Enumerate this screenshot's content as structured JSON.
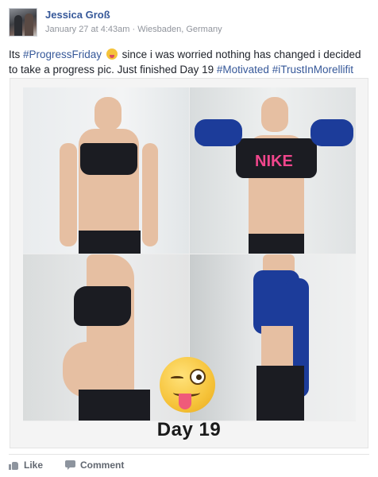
{
  "post": {
    "author": "Jessica Groß",
    "date": "January 27 at 4:43am",
    "separator": "·",
    "location": "Wiesbaden, Germany",
    "text": {
      "part1": "Its ",
      "hashtag1": "#ProgressFriday",
      "part2": " since i was worried nothing has changed i decided",
      "part3": "to take a progress pic. Just finished Day 19 ",
      "hashtag2": "#Motivated",
      "space": " ",
      "hashtag3": "#iTrustInMorellifit"
    },
    "image": {
      "caption": "Day 19",
      "shirt_text": "NIKE"
    }
  },
  "actions": {
    "like_label": "Like",
    "comment_label": "Comment"
  },
  "colors": {
    "link": "#365899",
    "meta": "#90949c",
    "action": "#616770"
  },
  "icons": [
    "avatar",
    "winking-tongue-emoji-icon",
    "thumbs-up-icon",
    "comment-icon"
  ]
}
